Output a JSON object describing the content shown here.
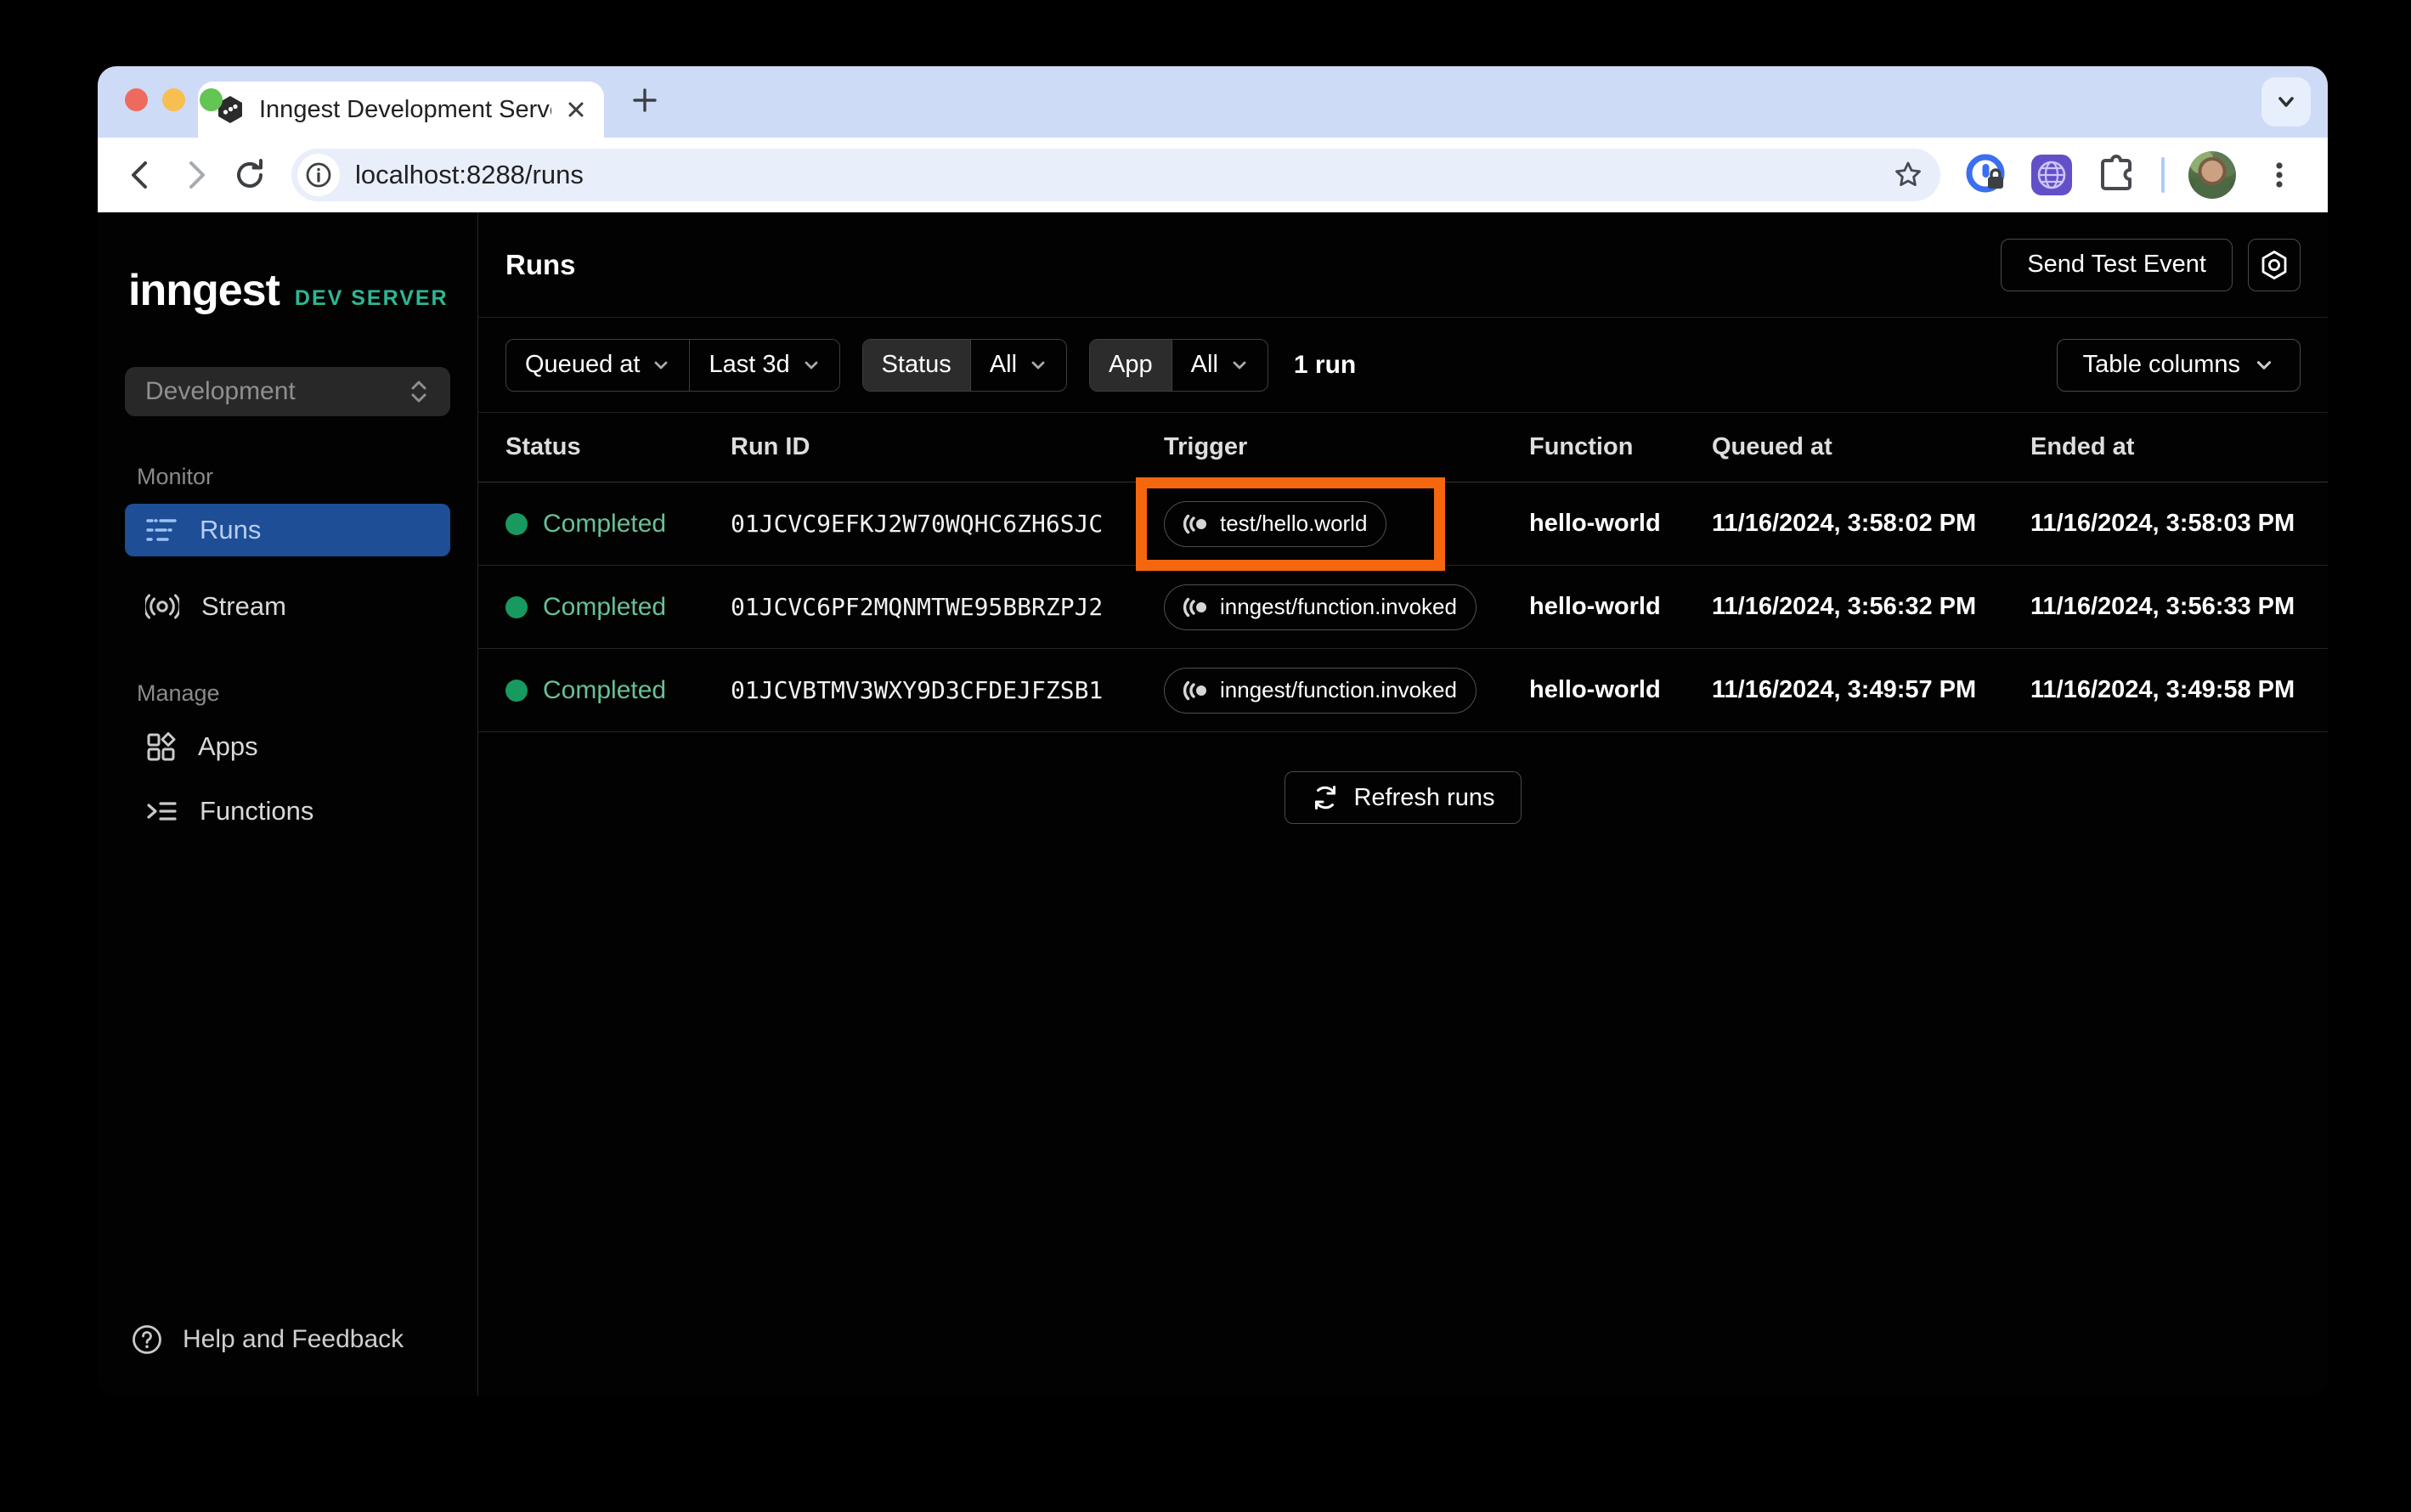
{
  "browser": {
    "tab_title": "Inngest Development Server",
    "url": "localhost:8288/runs"
  },
  "sidebar": {
    "logo": "inngest",
    "logo_badge": "DEV SERVER",
    "env_select": "Development",
    "monitor_label": "Monitor",
    "runs_label": "Runs",
    "stream_label": "Stream",
    "manage_label": "Manage",
    "apps_label": "Apps",
    "functions_label": "Functions",
    "help_label": "Help and Feedback"
  },
  "header": {
    "title": "Runs",
    "send_test_event": "Send Test Event"
  },
  "filters": {
    "queued_at": "Queued at",
    "time_range": "Last 3d",
    "status_label": "Status",
    "status_value": "All",
    "app_label": "App",
    "app_value": "All",
    "run_count": "1 run",
    "table_columns": "Table columns"
  },
  "table": {
    "columns": [
      "Status",
      "Run ID",
      "Trigger",
      "Function",
      "Queued at",
      "Ended at"
    ],
    "refresh": "Refresh runs",
    "rows": [
      {
        "status": "Completed",
        "run_id": "01JCVC9EFKJ2W70WQHC6ZH6SJC",
        "trigger": "test/hello.world",
        "function": "hello-world",
        "queued_at": "11/16/2024, 3:58:02 PM",
        "ended_at": "11/16/2024, 3:58:03 PM",
        "highlighted": true
      },
      {
        "status": "Completed",
        "run_id": "01JCVC6PF2MQNMTWE95BBRZPJ2",
        "trigger": "inngest/function.invoked",
        "function": "hello-world",
        "queued_at": "11/16/2024, 3:56:32 PM",
        "ended_at": "11/16/2024, 3:56:33 PM",
        "highlighted": false
      },
      {
        "status": "Completed",
        "run_id": "01JCVBTMV3WXY9D3CFDEJFZSB1",
        "trigger": "inngest/function.invoked",
        "function": "hello-world",
        "queued_at": "11/16/2024, 3:49:57 PM",
        "ended_at": "11/16/2024, 3:49:58 PM",
        "highlighted": false
      }
    ]
  },
  "colors": {
    "accent_green": "#2cb795",
    "selected_blue": "#1d4e96",
    "status_dot_green": "#17995f",
    "status_text_green": "#68c096",
    "highlight_orange": "#f4670f",
    "tabstrip_blue": "#cedbf7"
  }
}
